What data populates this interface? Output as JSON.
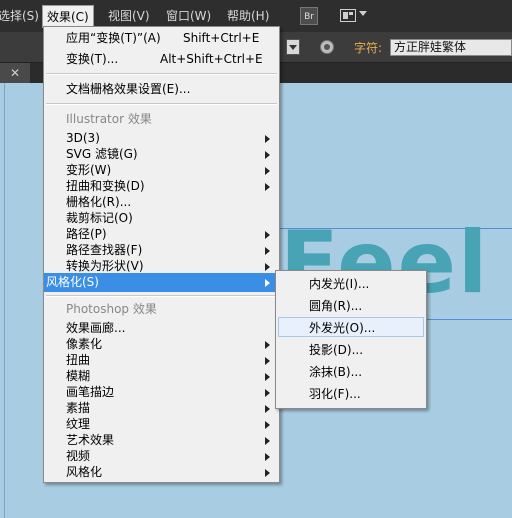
{
  "menubar": {
    "items": [
      "选择(S)",
      "效果(C)",
      "视图(V)",
      "窗口(W)",
      "帮助(H)"
    ],
    "bridge_label": "Br"
  },
  "controlbar": {
    "char_label": "字符:",
    "font_value": "方正胖娃繁体"
  },
  "canvas": {
    "artwork_text": "Feel"
  },
  "effects_menu": {
    "apply_last": {
      "label": "应用“变换(T)”(A)",
      "shortcut": "Shift+Ctrl+E"
    },
    "last_effect": {
      "label": "变换(T)...",
      "shortcut": "Alt+Shift+Ctrl+E"
    },
    "raster_settings": "文档栅格效果设置(E)...",
    "illustrator_section": "Illustrator 效果",
    "illustrator_items": [
      "3D(3)",
      "SVG 滤镜(G)",
      "变形(W)",
      "扭曲和变换(D)",
      "栅格化(R)...",
      "裁剪标记(O)",
      "路径(P)",
      "路径查找器(F)",
      "转换为形状(V)",
      "风格化(S)"
    ],
    "photoshop_section": "Photoshop 效果",
    "photoshop_items": [
      "效果画廊...",
      "像素化",
      "扭曲",
      "模糊",
      "画笔描边",
      "素描",
      "纹理",
      "艺术效果",
      "视频",
      "风格化"
    ]
  },
  "stylize_submenu": {
    "items": [
      "内发光(I)...",
      "圆角(R)...",
      "外发光(O)...",
      "投影(D)...",
      "涂抹(B)...",
      "羽化(F)..."
    ],
    "hovered_index": 2
  },
  "colors": {
    "highlight": "#3a8ee6",
    "canvas": "#a8cde2",
    "text_art": "#48a3b5"
  }
}
